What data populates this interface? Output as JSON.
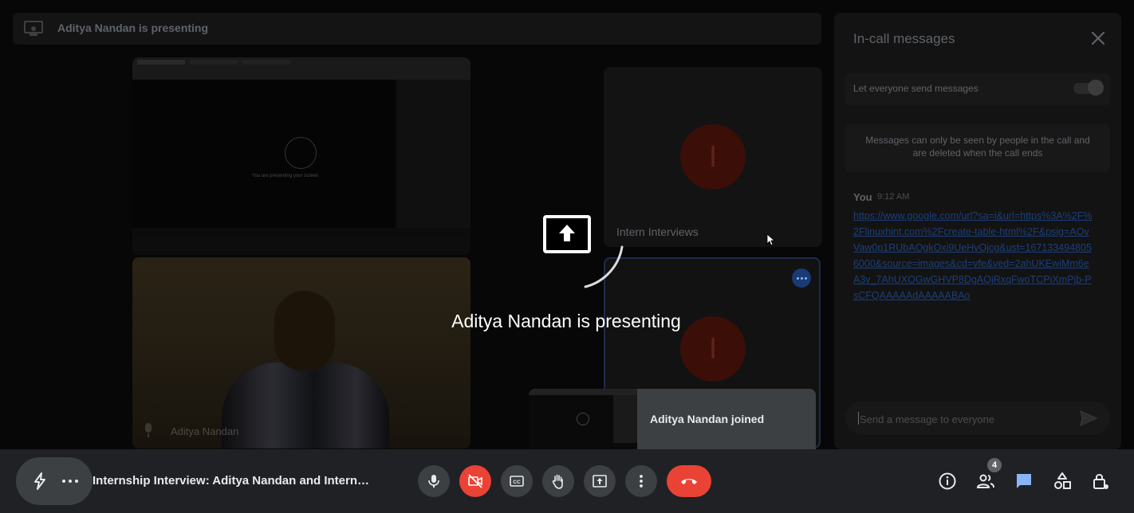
{
  "topbar": {
    "label": "Aditya Nandan is presenting"
  },
  "stage": {
    "screen_share": {
      "title_text": "You are presenting your screen"
    },
    "camera_tile": {
      "name": "Aditya Nandan"
    },
    "participant_tile_1": {
      "initial": "I",
      "name": "Intern Interviews"
    },
    "participant_tile_2": {
      "initial": "I"
    },
    "overlay": {
      "text": "Aditya Nandan is presenting"
    },
    "toast": {
      "text": "Aditya Nandan joined"
    }
  },
  "panel": {
    "title": "In-call messages",
    "toggle_label": "Let everyone send messages",
    "info": "Messages can only be seen by people in the call and are deleted when the call ends",
    "message": {
      "sender": "You",
      "time": "9:12 AM",
      "link": "https://www.google.com/url?sa=i&url=https%3A%2F%2Flinuxhint.com%2Fcreate-table-html%2F&psig=AOvVaw0p1RUbAOgkOxi9UeHvOjcg&ust=1671334948056000&source=images&cd=vfe&ved=2ahUKEwiMm6eA3v_7AhUXOGwGHVP8DgAQjRxqFwoTCPiXmPjb-PsCFQAAAAAdAAAAABAo"
    },
    "input_placeholder": "Send a message to everyone"
  },
  "bottom": {
    "meeting_title": "Internship Interview: Aditya Nandan and Intern Interviews",
    "people_count": "4"
  },
  "colors": {
    "end_call": "#ea4335",
    "control_bg": "#3c4043",
    "chat_active": "#8ab4f8",
    "bar_bg": "#202124"
  },
  "icons": [
    "presentation-icon",
    "screen-share-icon",
    "close-icon",
    "send-icon",
    "mic-icon",
    "camera-off-icon",
    "captions-icon",
    "raise-hand-icon",
    "present-icon",
    "more-options-icon",
    "end-call-icon",
    "info-icon",
    "people-icon",
    "chat-icon",
    "activities-icon",
    "host-controls-icon"
  ]
}
